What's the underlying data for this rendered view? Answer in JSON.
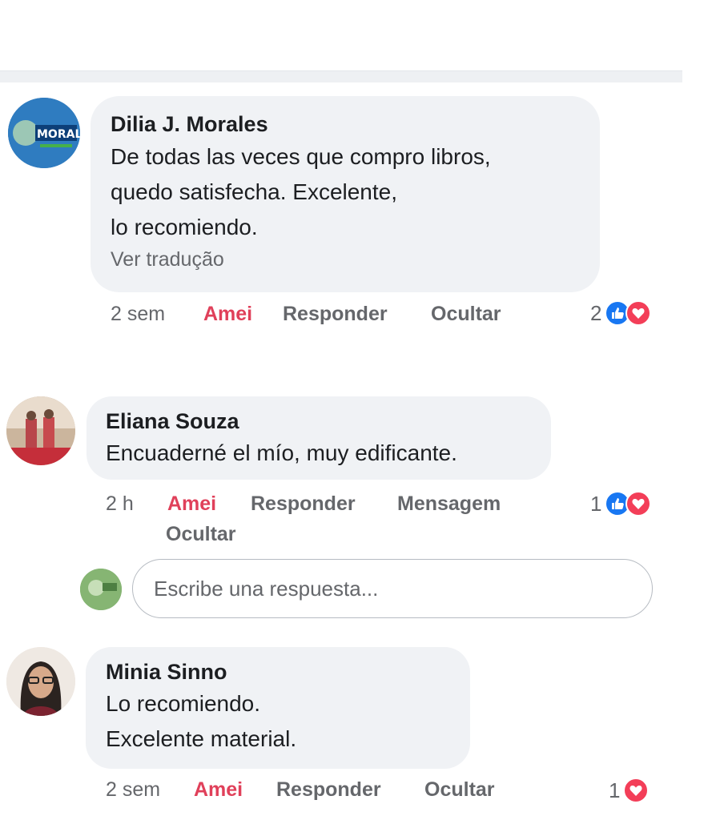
{
  "comments": [
    {
      "author": "Dilia J. Morales",
      "lines": [
        "De todas las veces que compro libros,",
        "quedo satisfecha. Excelente,",
        "lo recomiendo."
      ],
      "translate": "Ver tradução",
      "time": "2 sem",
      "love": "Amei",
      "reply": "Responder",
      "hide": "Ocultar",
      "reaction_count": "2",
      "reactions": [
        "like-icon",
        "love-icon"
      ]
    },
    {
      "author": "Eliana Souza",
      "lines": [
        "Encuaderné el mío,  muy edificante."
      ],
      "time": "2 h",
      "love": "Amei",
      "reply": "Responder",
      "message": "Mensagem",
      "hide": "Ocultar",
      "reaction_count": "1",
      "reactions": [
        "like-icon",
        "love-icon"
      ]
    },
    {
      "author": "Minia Sinno",
      "lines": [
        "Lo recomiendo.",
        "Excelente material."
      ],
      "time": "2 sem",
      "love": "Amei",
      "reply": "Responder",
      "hide": "Ocultar",
      "reaction_count": "1",
      "reactions": [
        "love-icon"
      ]
    }
  ],
  "reply_input": {
    "placeholder": "Escribe una respuesta..."
  },
  "colors": {
    "love": "#e0405a",
    "like": "#1877f2",
    "heart": "#f33e58",
    "bubble": "#f0f2f5"
  }
}
